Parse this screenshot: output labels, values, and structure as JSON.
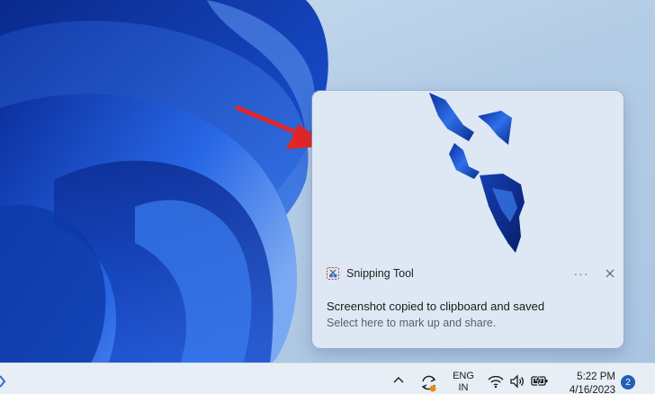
{
  "notification": {
    "app_name": "Snipping Tool",
    "title": "Screenshot copied to clipboard and saved",
    "body": "Select here to mark up and share.",
    "more_label": "···",
    "close_icon": "close-icon"
  },
  "taskbar": {
    "language_line1": "ENG",
    "language_line2": "IN",
    "time": "5:22 PM",
    "date": "4/16/2023",
    "notification_count": "2"
  },
  "colors": {
    "accent": "#1f5fb8",
    "arrow": "#e32626",
    "wallpaper_blue": "#0f3fc0"
  }
}
